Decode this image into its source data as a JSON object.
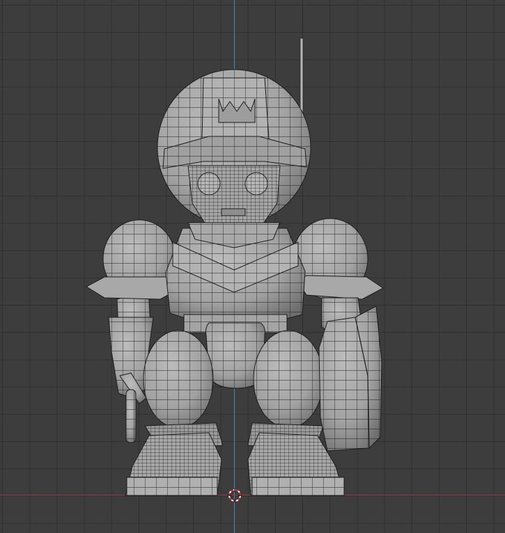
{
  "viewport": {
    "background_color": "#3d3d3d",
    "grid_color": "#2f2f2f",
    "axis_colors": {
      "x": "#9b3d44",
      "z": "#4a86b8"
    },
    "mesh_color": "#a6a6a6",
    "wire_color": "#1c1c1c",
    "object": "mech-pilot-mesh",
    "cursor_icon": "3d-cursor-icon"
  }
}
